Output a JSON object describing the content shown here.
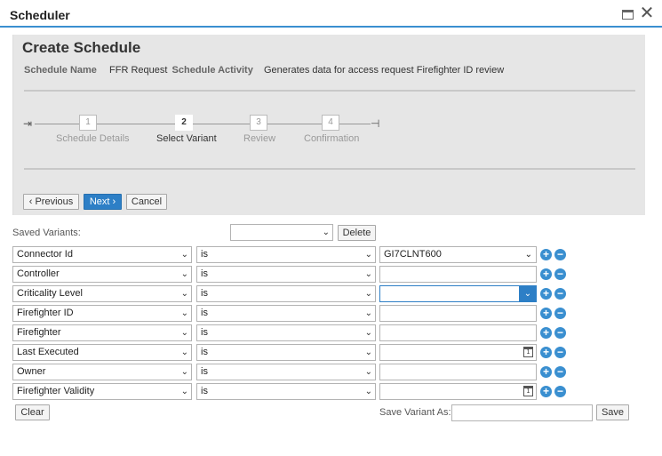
{
  "window": {
    "title": "Scheduler"
  },
  "header": {
    "title": "Create Schedule",
    "schedule_name_label": "Schedule Name",
    "schedule_name_value": "FFR Request",
    "schedule_activity_label": "Schedule Activity",
    "schedule_activity_value": "Generates data for access request Firefighter ID review"
  },
  "wizard": {
    "current_step": 2,
    "steps": [
      {
        "number": "1",
        "label": "Schedule Details"
      },
      {
        "number": "2",
        "label": "Select Variant"
      },
      {
        "number": "3",
        "label": "Review"
      },
      {
        "number": "4",
        "label": "Confirmation"
      }
    ]
  },
  "nav_buttons": {
    "previous": "Previous",
    "next": "Next",
    "cancel": "Cancel"
  },
  "variants": {
    "label": "Saved Variants:",
    "selected": "",
    "delete": "Delete"
  },
  "criteria": [
    {
      "field": "Connector Id",
      "operator": "is",
      "value": "GI7CLNT600",
      "input": "dropdown"
    },
    {
      "field": "Controller",
      "operator": "is",
      "value": "",
      "input": "text"
    },
    {
      "field": "Criticality Level",
      "operator": "is",
      "value": "",
      "input": "dropdown-focused"
    },
    {
      "field": "Firefighter ID",
      "operator": "is",
      "value": "",
      "input": "text"
    },
    {
      "field": "Firefighter",
      "operator": "is",
      "value": "",
      "input": "text"
    },
    {
      "field": "Last Executed",
      "operator": "is",
      "value": "",
      "input": "date"
    },
    {
      "field": "Owner",
      "operator": "is",
      "value": "",
      "input": "text"
    },
    {
      "field": "Firefighter Validity",
      "operator": "is",
      "value": "",
      "input": "date"
    }
  ],
  "footer": {
    "clear": "Clear",
    "save_as_label": "Save Variant As:",
    "save_as_value": "",
    "save": "Save"
  },
  "icons": {
    "add": "plus-circle-icon",
    "remove": "minus-circle-icon",
    "calendar": "calendar-icon",
    "calendar_day": "1"
  },
  "colors": {
    "accent": "#2d7fc6",
    "header_bg": "#e6e6e6"
  }
}
